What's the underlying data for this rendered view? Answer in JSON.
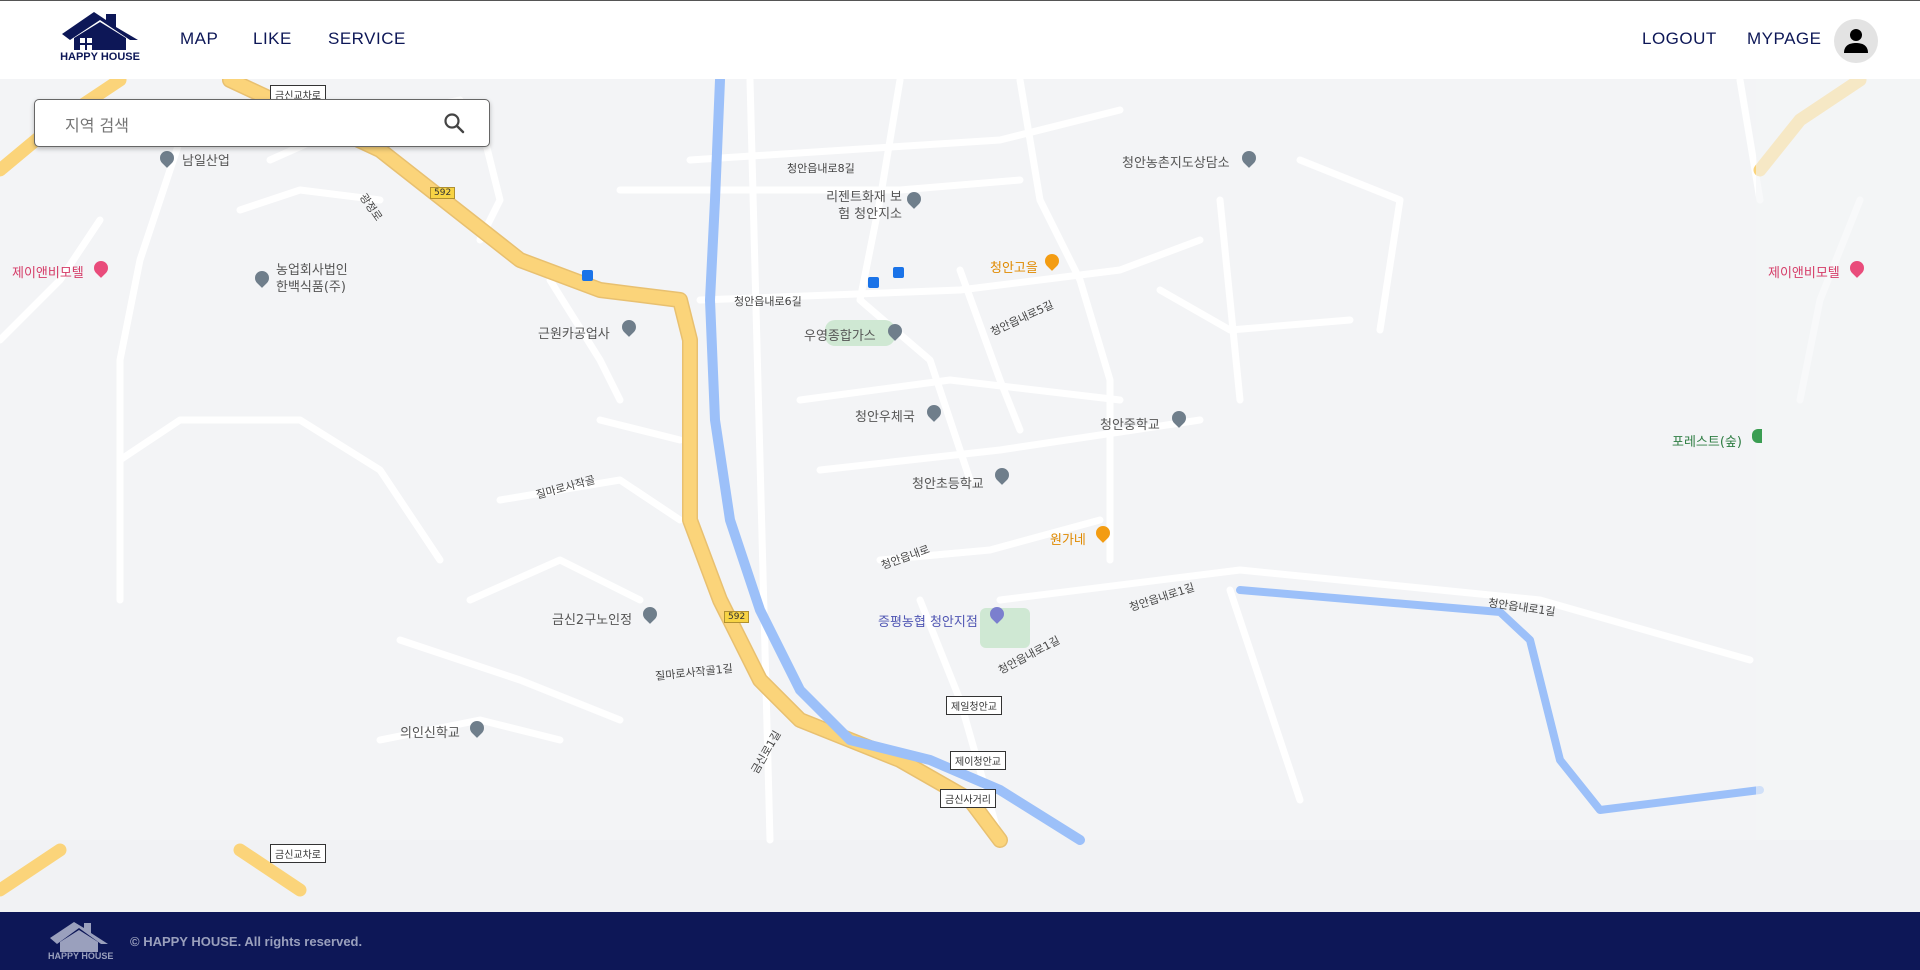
{
  "header": {
    "logo_text": "HAPPY HOUSE",
    "nav_left": [
      "MAP",
      "LIKE",
      "SERVICE"
    ],
    "nav_right": [
      "LOGOUT",
      "MYPAGE"
    ]
  },
  "search": {
    "placeholder": "지역 검색",
    "value": ""
  },
  "map": {
    "labels": [
      {
        "text": "금신교차로",
        "kind": "road-sign"
      },
      {
        "text": "남일산업",
        "kind": "poi"
      },
      {
        "text": "제이앤비모텔",
        "kind": "hotel"
      },
      {
        "text": "농업회사법인 한백식품(주)",
        "kind": "poi"
      },
      {
        "text": "근원카공업사",
        "kind": "poi"
      },
      {
        "text": "청안읍내로8길",
        "kind": "road"
      },
      {
        "text": "리젠트화재 보험 청안지소",
        "kind": "poi"
      },
      {
        "text": "청안읍내로6길",
        "kind": "road"
      },
      {
        "text": "우영종합가스",
        "kind": "poi"
      },
      {
        "text": "청안고을",
        "kind": "restaurant"
      },
      {
        "text": "청안농촌지도상담소",
        "kind": "poi"
      },
      {
        "text": "청안읍내로5길",
        "kind": "road"
      },
      {
        "text": "청안우체국",
        "kind": "poi"
      },
      {
        "text": "청안중학교",
        "kind": "school"
      },
      {
        "text": "청안초등학교",
        "kind": "school"
      },
      {
        "text": "원가네",
        "kind": "restaurant"
      },
      {
        "text": "청안읍내로",
        "kind": "road"
      },
      {
        "text": "증평농협 청안지점",
        "kind": "bank"
      },
      {
        "text": "청안읍내로1길",
        "kind": "road"
      },
      {
        "text": "금신2구노인정",
        "kind": "poi"
      },
      {
        "text": "의인신학교",
        "kind": "poi"
      },
      {
        "text": "질마로사작골1길",
        "kind": "road"
      },
      {
        "text": "질마로사작골",
        "kind": "road"
      },
      {
        "text": "제일청안교",
        "kind": "road-sign"
      },
      {
        "text": "제이청안교",
        "kind": "road-sign"
      },
      {
        "text": "금신사거리",
        "kind": "road-sign"
      },
      {
        "text": "포레스트(숲)",
        "kind": "park"
      },
      {
        "text": "592",
        "kind": "route-shield"
      },
      {
        "text": "광정로",
        "kind": "road"
      },
      {
        "text": "금신로1길",
        "kind": "road"
      }
    ]
  },
  "footer": {
    "logo_text": "HAPPY HOUSE",
    "copyright": "© HAPPY HOUSE. All rights reserved."
  },
  "colors": {
    "navy": "#0d1757",
    "road_major": "#fbd47a",
    "water": "#9cc0f9",
    "map_bg": "#f3f4f6"
  },
  "icons": [
    "house-logo-icon",
    "user-avatar-icon",
    "search-icon",
    "bus-stop-icon",
    "map-pin-icon"
  ]
}
